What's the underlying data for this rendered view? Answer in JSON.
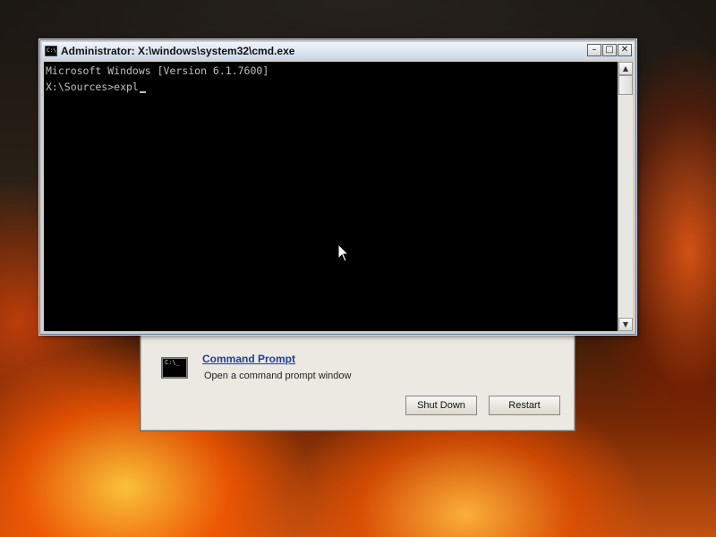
{
  "window": {
    "title": "Administrator: X:\\windows\\system32\\cmd.exe",
    "icon_text": "C:\\_",
    "controls": {
      "minimize_label": "–",
      "maximize_label": "□",
      "close_label": "✕"
    }
  },
  "console": {
    "lines": [
      "Microsoft Windows [Version 6.1.7600]",
      "",
      "X:\\Sources>expl"
    ]
  },
  "setup_panel": {
    "item_icon_text": "C:\\_",
    "item_title": "Command Prompt",
    "item_description": "Open a command prompt window",
    "shutdown_label": "Shut Down",
    "restart_label": "Restart"
  },
  "colors": {
    "console_bg": "#000000",
    "console_fg": "#c0c0c0",
    "link_blue": "#1a3fa0"
  },
  "icons": {
    "window_icon": "cmd-icon",
    "item_icon": "cmd-icon",
    "pointer": "mouse-pointer-icon"
  }
}
